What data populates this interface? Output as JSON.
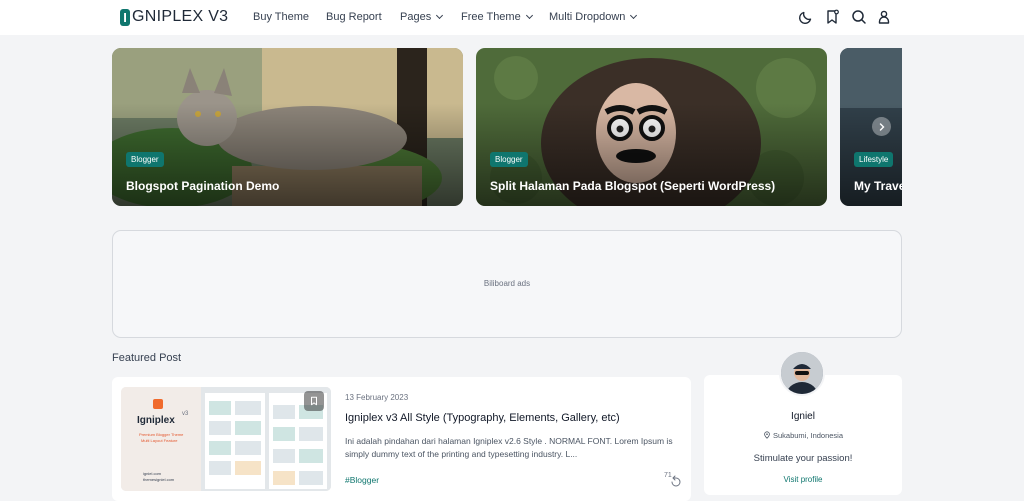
{
  "brand": {
    "mark": "I",
    "name": "GNIPLEX V3"
  },
  "nav": {
    "items": [
      {
        "label": "Buy Theme"
      },
      {
        "label": "Bug Report"
      },
      {
        "label": "Pages"
      },
      {
        "label": "Free Theme"
      },
      {
        "label": "Multi Dropdown"
      }
    ]
  },
  "toolbar_icons": [
    "moon-icon",
    "bookmark-icon",
    "search-icon",
    "user-icon"
  ],
  "slider": {
    "slides": [
      {
        "badge": "Blogger",
        "title": "Blogspot Pagination Demo"
      },
      {
        "badge": "Blogger",
        "title": "Split Halaman Pada Blogspot (Seperti WordPress)"
      },
      {
        "badge": "Lifestyle",
        "title": "My Trave"
      }
    ]
  },
  "ads": {
    "label": "Biliboard ads"
  },
  "featured": {
    "heading": "Featured Post",
    "thumb": {
      "brand": "Igniplex",
      "version": "v3",
      "sub1": "Premium Blogger Theme",
      "sub2": "Multi Layout Feature",
      "sites1": "igniel.com",
      "sites2": "themesigniel.com"
    },
    "date": "13 February 2023",
    "title": "Igniplex v3 All Style (Typography, Elements, Gallery, etc)",
    "excerpt": "Ini adalah pindahan dari halaman Igniplex v2.6 Style . NORMAL FONT. Lorem Ipsum is simply dummy text of the printing and typesetting industry. L...",
    "tag": "#Blogger",
    "count": "71"
  },
  "profile": {
    "name": "Igniel",
    "location": "Sukabumi, Indonesia",
    "bio": "Stimulate your passion!",
    "link": "Visit profile"
  },
  "colors": {
    "accent": "#0f766e",
    "background": "#f3f4f6"
  }
}
